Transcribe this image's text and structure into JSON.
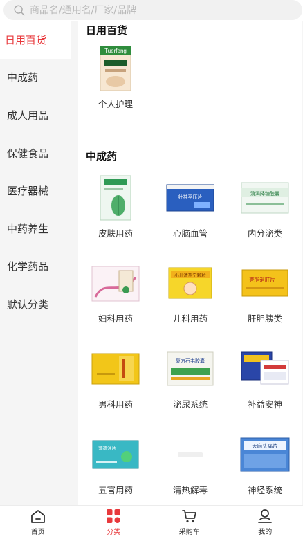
{
  "search": {
    "placeholder": "商品名/通用名/厂家/品牌"
  },
  "sidebar": {
    "items": [
      {
        "label": "日用百货",
        "active": true
      },
      {
        "label": "中成药"
      },
      {
        "label": "成人用品"
      },
      {
        "label": "保健食品"
      },
      {
        "label": "医疗器械"
      },
      {
        "label": "中药养生"
      },
      {
        "label": "化学药品"
      },
      {
        "label": "默认分类"
      }
    ]
  },
  "sections": [
    {
      "title": "日用百货",
      "items": [
        {
          "label": "个人护理",
          "box_text": "Tuerfeng"
        }
      ]
    },
    {
      "title": "中成药",
      "items": [
        {
          "label": "皮肤用药"
        },
        {
          "label": "心脑血管",
          "box_text": "壮神平压片"
        },
        {
          "label": "内分泌类",
          "box_text": "消渴降糖胶囊"
        },
        {
          "label": "妇科用药"
        },
        {
          "label": "儿科用药",
          "box_text": "小儿清热宁颗粒"
        },
        {
          "label": "肝胆胰类",
          "box_text": "壳脂消肝片"
        },
        {
          "label": "男科用药"
        },
        {
          "label": "泌尿系统",
          "box_text": "复方石韦胶囊"
        },
        {
          "label": "补益安神"
        },
        {
          "label": "五官用药",
          "box_text": "薄荷油片"
        },
        {
          "label": "清热解毒"
        },
        {
          "label": "神经系统",
          "box_text": "天麻头痛片"
        }
      ]
    }
  ],
  "tabbar": {
    "items": [
      {
        "label": "首页",
        "icon": "home-icon"
      },
      {
        "label": "分类",
        "icon": "category-icon",
        "active": true
      },
      {
        "label": "采购车",
        "icon": "cart-icon"
      },
      {
        "label": "我的",
        "icon": "profile-icon"
      }
    ]
  },
  "colors": {
    "accent": "#e8393c",
    "background": "#f5f5f5"
  }
}
